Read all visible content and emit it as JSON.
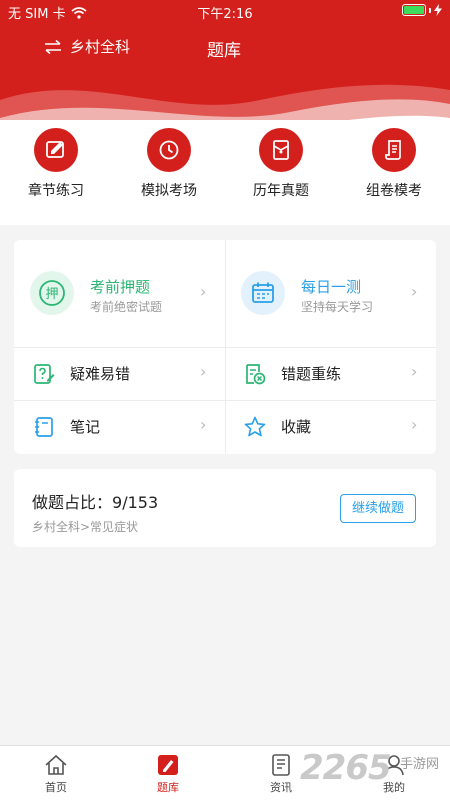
{
  "status": {
    "carrier": "无 SIM 卡",
    "time": "下午2:16"
  },
  "header": {
    "subject": "乡村全科",
    "title": "题库"
  },
  "quick_actions": [
    {
      "label": "章节练习",
      "icon": "edit-doc-icon"
    },
    {
      "label": "模拟考场",
      "icon": "clock-icon"
    },
    {
      "label": "历年真题",
      "icon": "envelope-doc-icon"
    },
    {
      "label": "组卷模考",
      "icon": "scroll-icon"
    }
  ],
  "features": {
    "press": {
      "title": "考前押题",
      "subtitle": "考前绝密试题",
      "badge": "押"
    },
    "daily": {
      "title": "每日一测",
      "subtitle": "坚持每天学习"
    },
    "difficult": {
      "label": "疑难易错"
    },
    "wrong": {
      "label": "错题重练"
    },
    "notes": {
      "label": "笔记"
    },
    "favorites": {
      "label": "收藏"
    }
  },
  "progress": {
    "label": "做题占比：",
    "value": "9/153",
    "path": "乡村全科>常见症状",
    "continue_label": "继续做题"
  },
  "tabs": [
    {
      "label": "首页",
      "icon": "home-icon",
      "active": false
    },
    {
      "label": "题库",
      "icon": "pencil-icon",
      "active": true
    },
    {
      "label": "资讯",
      "icon": "news-icon",
      "active": false
    },
    {
      "label": "我的",
      "icon": "person-icon",
      "active": false
    }
  ],
  "watermark": {
    "number": "2265",
    "text": "手游网"
  },
  "colors": {
    "primary": "#d4201c",
    "green": "#2bb673",
    "blue": "#2aa0e8"
  }
}
